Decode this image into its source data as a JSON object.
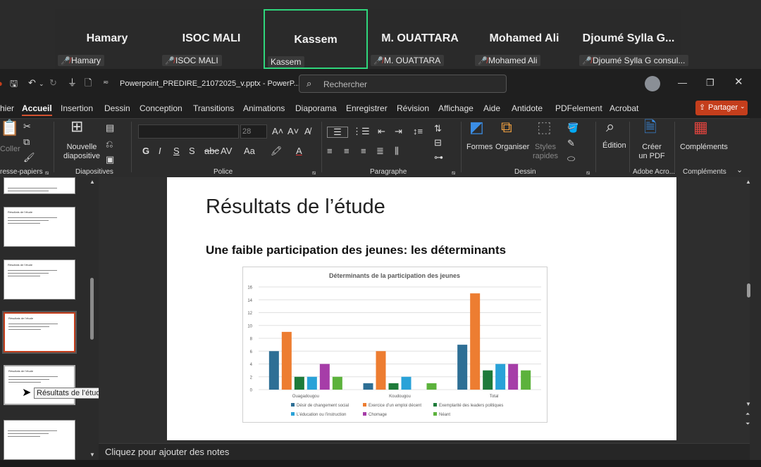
{
  "meeting": {
    "participants": [
      {
        "name": "Hamary",
        "label": "Hamary",
        "active": false
      },
      {
        "name": "ISOC MALI",
        "label": "ISOC MALI",
        "active": false
      },
      {
        "name": "Kassem",
        "label": "Kassem",
        "active": true
      },
      {
        "name": "M. OUATTARA",
        "label": "M. OUATTARA",
        "active": false
      },
      {
        "name": "Mohamed Ali",
        "label": "Mohamed Ali",
        "active": false
      },
      {
        "name": "Djoumé Sylla G...",
        "label": "Djoumé Sylla G consul...",
        "active": false
      }
    ]
  },
  "titlebar": {
    "filename": "Powerpoint_PREDIRE_21072025_v.pptx  -  PowerP...",
    "search_placeholder": "Rechercher"
  },
  "ribbon_tabs": [
    "hier",
    "Accueil",
    "Insertion",
    "Dessin",
    "Conception",
    "Transitions",
    "Animations",
    "Diaporama",
    "Enregistrer",
    "Révision",
    "Affichage",
    "Aide",
    "Antidote",
    "PDFelement",
    "Acrobat"
  ],
  "share_label": "Partager",
  "ribbon": {
    "coller": "Coller",
    "presse_papiers": "resse-papiers",
    "nouvelle_diapositive": "Nouvelle diapositive",
    "diapositives": "Diapositives",
    "police": "Police",
    "font_size": "28",
    "paragraphe": "Paragraphe",
    "formes": "Formes",
    "organiser": "Organiser",
    "styles_rapides": "Styles rapides",
    "dessin": "Dessin",
    "edition": "Édition",
    "creer_pdf": "Créer un PDF",
    "adobe_acro": "Adobe Acro...",
    "complements_btn": "Compléments",
    "complements": "Compléments"
  },
  "thumbnails": [
    {
      "title": ""
    },
    {
      "title": "Résultats de l’étude"
    },
    {
      "title": "Résultats de l’étude"
    },
    {
      "title": "Résultats de l’étude",
      "selected": true
    },
    {
      "title": "Résultats de l’étude",
      "hover": true
    },
    {
      "title": ""
    }
  ],
  "tooltip": "Résultats de l’étude",
  "slide": {
    "title": "Résultats de l’étude",
    "subtitle": "Une faible participation des jeunes: les déterminants"
  },
  "notes_placeholder": "Cliquez pour ajouter des notes",
  "colors": {
    "accent": "#c43e1c",
    "meeting_active": "#2fd67c"
  },
  "chart_data": {
    "type": "bar",
    "title": "Déterminants de la participation des jeunes",
    "categories": [
      "Ouagadougou",
      "Koudougou",
      "Total"
    ],
    "ylim": [
      0,
      16
    ],
    "yticks": [
      0,
      2,
      4,
      6,
      8,
      10,
      12,
      14,
      16
    ],
    "legend_position": "bottom",
    "series": [
      {
        "name": "Désir de changement social",
        "color": "#2e6f95",
        "values": [
          6,
          1,
          7
        ]
      },
      {
        "name": "Exercice d’un emploi décent",
        "color": "#ed7d31",
        "values": [
          9,
          6,
          15
        ]
      },
      {
        "name": "Exemplarité des leaders politiques",
        "color": "#1e7b3a",
        "values": [
          2,
          1,
          3
        ]
      },
      {
        "name": "L’éducation ou l’instruction",
        "color": "#29a2d8",
        "values": [
          2,
          2,
          4
        ]
      },
      {
        "name": "Chomage",
        "color": "#a63da8",
        "values": [
          4,
          0,
          4
        ]
      },
      {
        "name": "Néant",
        "color": "#5cb23c",
        "values": [
          2,
          1,
          3
        ]
      }
    ]
  }
}
